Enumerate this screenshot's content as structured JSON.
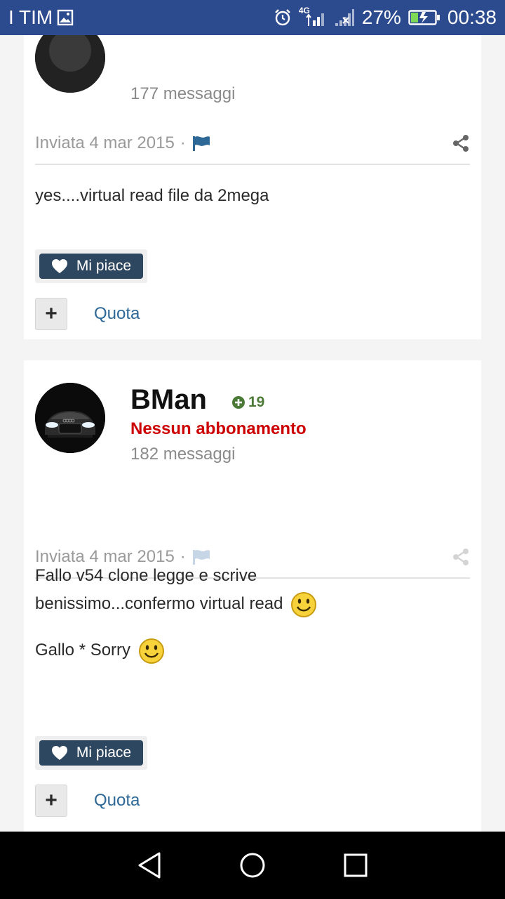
{
  "status_bar": {
    "carrier": "I TIM",
    "network": "4G",
    "battery": "27%",
    "time": "00:38"
  },
  "posts": [
    {
      "author_posts": "177 messaggi",
      "date": "Inviata 4 mar 2015",
      "body": [
        "yes....virtual read file da 2mega"
      ],
      "like_label": "Mi piace",
      "quote_label": "Quota",
      "flag_icon": "flag-icon",
      "share_icon": "share-icon"
    },
    {
      "author_name": "BMan",
      "reputation": "19",
      "group": "Nessun abbonamento",
      "author_posts": "182 messaggi",
      "date": "Inviata 4 mar 2015",
      "body": [
        "Fallo v54 clone legge e scrive benissimo...confermo virtual read",
        "Gallo * Sorry"
      ],
      "like_label": "Mi piace",
      "quote_label": "Quota",
      "flag_icon": "flag-icon",
      "share_icon": "share-icon"
    }
  ],
  "colors": {
    "status_bar": "#2c4a8e",
    "like_button": "#2e4761",
    "group_red": "#cc0000",
    "link_blue": "#2d6896",
    "rep_green": "#4b7a36"
  }
}
